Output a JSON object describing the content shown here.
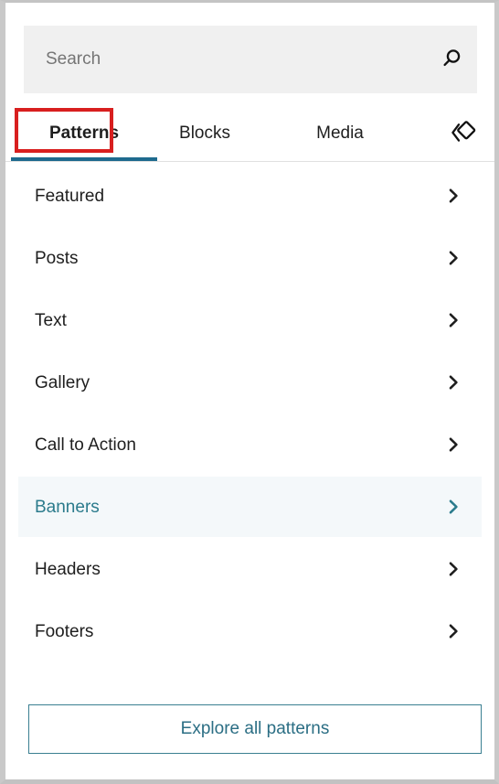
{
  "search": {
    "placeholder": "Search",
    "value": "",
    "icon": "search-icon"
  },
  "tabs": {
    "items": [
      {
        "label": "Patterns",
        "active": true
      },
      {
        "label": "Blocks",
        "active": false
      },
      {
        "label": "Media",
        "active": false
      }
    ],
    "trailing_icon": "reusable-block-icon",
    "active_underline_color": "#1e6a8e",
    "annotation_highlight_color": "#d81f1f"
  },
  "categories": {
    "items": [
      {
        "label": "Featured",
        "icon": "chevron-right-icon",
        "selected": false
      },
      {
        "label": "Posts",
        "icon": "chevron-right-icon",
        "selected": false
      },
      {
        "label": "Text",
        "icon": "chevron-right-icon",
        "selected": false
      },
      {
        "label": "Gallery",
        "icon": "chevron-right-icon",
        "selected": false
      },
      {
        "label": "Call to Action",
        "icon": "chevron-right-icon",
        "selected": false
      },
      {
        "label": "Banners",
        "icon": "chevron-right-icon",
        "selected": true
      },
      {
        "label": "Headers",
        "icon": "chevron-right-icon",
        "selected": false
      },
      {
        "label": "Footers",
        "icon": "chevron-right-icon",
        "selected": false
      }
    ],
    "selected_bg": "#f4f8fa",
    "selected_fg": "#2b7b8c"
  },
  "footer": {
    "explore_label": "Explore all patterns",
    "accent": "#3a7f91"
  }
}
